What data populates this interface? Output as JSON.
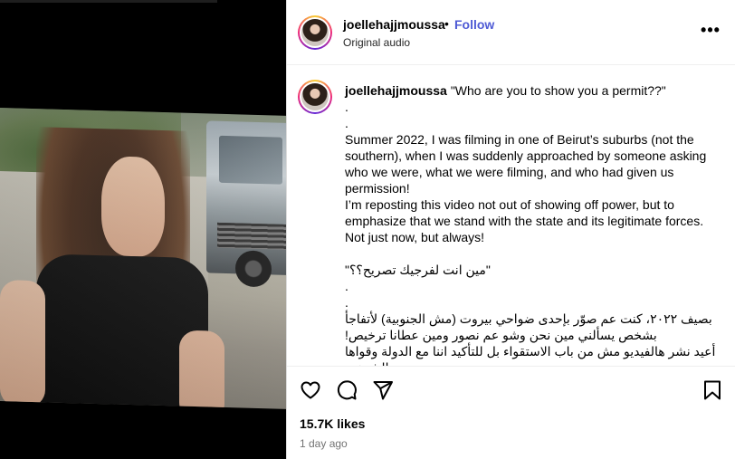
{
  "post": {
    "username": "joellehajjmoussa",
    "separator": "•",
    "follow_label": "Follow",
    "audio_label": "Original audio",
    "more_label": "•••"
  },
  "caption": {
    "username": "joellehajjmoussa",
    "title": "\"Who are you to show you a permit??\"",
    "lines": [
      ".",
      ".",
      "Summer 2022, I was filming in one of Beirut’s suburbs (not the southern), when I was suddenly approached by someone asking who we were, what we were filming, and who had given us permission!",
      "I’m reposting this video not out of showing off power, but to emphasize that we stand with the state and its legitimate forces. Not just now, but always!",
      "",
      "\"مين انت لفرجيك تصريح؟؟\"",
      ".",
      ".",
      "بصيف ٢٠٢٢، كنت عم صوّر بإحدى ضواحي بيروت (مش الجنوبية) لأتفاجأ بشخص يسألني مين نحن وشو عم نصور ومين عطانا ترخيص!",
      "أعيد نشر هالفيديو مش من باب الاستقواء بل للتأكيد اننا مع الدولة وقواها الشرعية"
    ]
  },
  "actions": {
    "like_icon": "heart-icon",
    "comment_icon": "comment-icon",
    "share_icon": "paper-plane-icon",
    "save_icon": "bookmark-icon"
  },
  "stats": {
    "likes": "15.7K likes",
    "timestamp": "1 day ago"
  },
  "colors": {
    "follow": "#4f5bd5",
    "secondary_text": "#737373"
  }
}
